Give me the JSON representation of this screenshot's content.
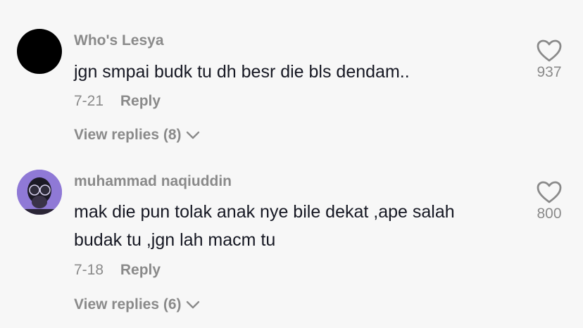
{
  "comments": [
    {
      "username": "Who's Lesya",
      "text": "jgn smpai budk tu dh besr die bls dendam..",
      "date": "7-21",
      "reply_label": "Reply",
      "view_replies": "View replies (8)",
      "likes": "937",
      "avatar_color": "#000000"
    },
    {
      "username": "muhammad naqiuddin",
      "text": "mak die pun tolak anak nye bile dekat ,ape salah budak tu ,jgn lah macm tu",
      "date": "7-18",
      "reply_label": "Reply",
      "view_replies": "View replies (6)",
      "likes": "800",
      "avatar_color": "#8f79d6"
    }
  ],
  "icons": {
    "like": "heart-outline-icon",
    "expand": "chevron-down-icon"
  },
  "colors": {
    "background": "#f7f7f7",
    "primary_text": "#161823",
    "secondary_text": "#8a8a8a"
  }
}
